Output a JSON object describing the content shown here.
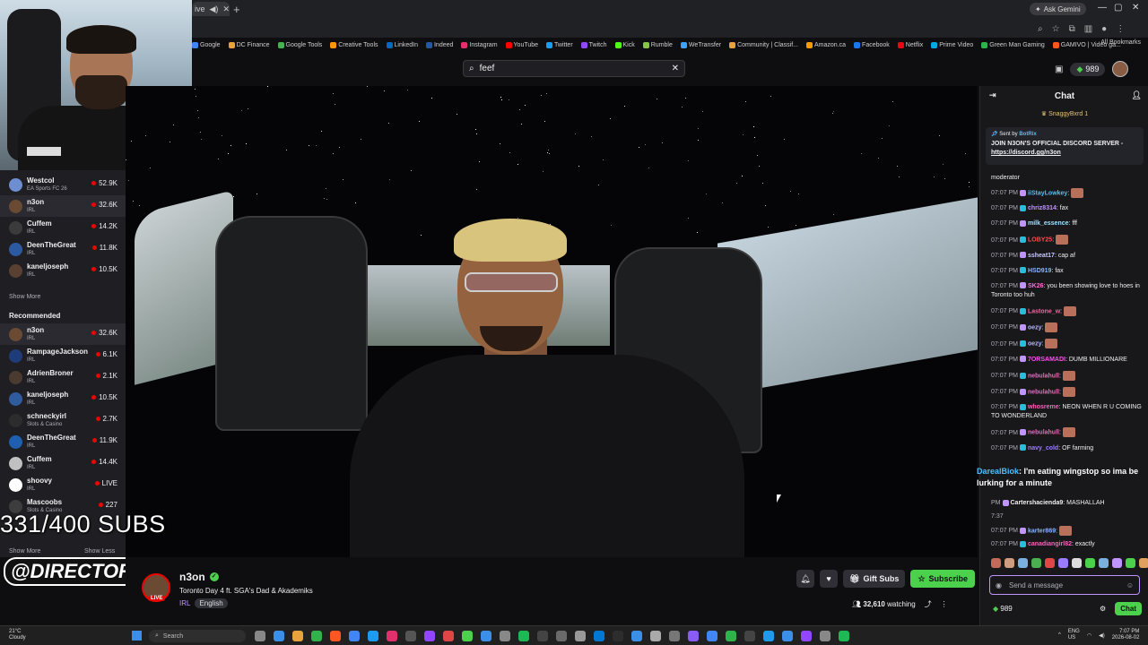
{
  "browser": {
    "tab_title": "ive",
    "ask_gemini": "Ask Gemini",
    "bookmarks": [
      "Google",
      "DC Finance",
      "Google Tools",
      "Creative Tools",
      "LinkedIn",
      "Indeed",
      "Instagram",
      "YouTube",
      "Twitter",
      "Twitch",
      "Kick",
      "Rumble",
      "WeTransfer",
      "Community | Classif...",
      "Amazon.ca",
      "Facebook",
      "Netflix",
      "Prime Video",
      "Green Man Gaming",
      "GAMIVO | Video ga..."
    ],
    "all_bookmarks": "All Bookmarks"
  },
  "search": {
    "value": "feef"
  },
  "top_right": {
    "bits": "989"
  },
  "sidebar": {
    "followed": [
      {
        "name": "Westcol",
        "category": "EA Sports FC 26",
        "count": "52.9K"
      },
      {
        "name": "n3on",
        "category": "IRL",
        "count": "32.6K"
      },
      {
        "name": "Cuffem",
        "category": "IRL",
        "count": "14.2K"
      },
      {
        "name": "DeenTheGreat",
        "category": "IRL",
        "count": "11.8K"
      },
      {
        "name": "kaneljoseph",
        "category": "IRL",
        "count": "10.5K"
      }
    ],
    "show_more": "Show More",
    "recommended_heading": "Recommended",
    "recommended": [
      {
        "name": "n3on",
        "category": "IRL",
        "count": "32.6K"
      },
      {
        "name": "RampageJackson",
        "category": "IRL",
        "count": "6.1K"
      },
      {
        "name": "AdrienBroner",
        "category": "IRL",
        "count": "2.1K"
      },
      {
        "name": "kaneljoseph",
        "category": "IRL",
        "count": "10.5K"
      },
      {
        "name": "schneckyirl",
        "category": "Slots & Casino",
        "count": "2.7K"
      },
      {
        "name": "DeenTheGreat",
        "category": "IRL",
        "count": "11.9K"
      },
      {
        "name": "Cuffem",
        "category": "IRL",
        "count": "14.4K"
      },
      {
        "name": "shoovy",
        "category": "IRL",
        "count": "LIVE"
      },
      {
        "name": "Mascoobs",
        "category": "Slots & Casino",
        "count": "227"
      }
    ],
    "show_more_2": "Show More",
    "show_less": "Show Less"
  },
  "overlay": {
    "subs": "331/400 SUBS",
    "handle": "@DIRECTORICY"
  },
  "stream": {
    "channel": "n3on",
    "live": "LIVE",
    "title": "Toronto Day 4 ft. SGA's Dad & Akademiks",
    "category": "IRL",
    "language": "English",
    "gift_subs": "Gift Subs",
    "subscribe": "Subscribe",
    "viewers": "32,610",
    "watching": "watching"
  },
  "chat": {
    "header": "Chat",
    "gifter": "SnaggyBxrd 1",
    "pinned_from_label": "Sent by",
    "pinned_from": "BotRix",
    "pinned_msg": "JOIN N3ON'S OFFICIAL DISCORD SERVER -",
    "pinned_link": "https://discord.gg/n3on",
    "moderator": "moderator",
    "messages": [
      {
        "time": "07:07 PM",
        "user": "iiStayLowkey",
        "color": "#49c1ff",
        "text": ""
      },
      {
        "time": "07:07 PM",
        "user": "chriz8314",
        "color": "#bf94ff",
        "text": "fax"
      },
      {
        "time": "07:07 PM",
        "user": "milk_essence",
        "color": "#a0e0ff",
        "text": "fff"
      },
      {
        "time": "07:07 PM",
        "user": "LOBY25",
        "color": "#ff4c4c",
        "text": ""
      },
      {
        "time": "07:07 PM",
        "user": "ssheat17",
        "color": "#c7c7ff",
        "text": "cap af"
      },
      {
        "time": "07:07 PM",
        "user": "HSD919",
        "color": "#8ab4ff",
        "text": "fax"
      },
      {
        "time": "07:07 PM",
        "user": "SK26",
        "color": "#ff6bd5",
        "text": "you been showing love to hoes in Toronto too huh"
      },
      {
        "time": "07:07 PM",
        "user": "Lastone_w",
        "color": "#ff5fa2",
        "text": ""
      },
      {
        "time": "07:07 PM",
        "user": "oezy",
        "color": "#b4b4ff",
        "text": ""
      },
      {
        "time": "07:07 PM",
        "user": "oezy",
        "color": "#b4b4ff",
        "text": ""
      },
      {
        "time": "07:07 PM",
        "user": "7ORSAMADI",
        "color": "#ff4df0",
        "text": "DUMB MILLIONARE"
      },
      {
        "time": "07:07 PM",
        "user": "nebulahull",
        "color": "#ff5fbf",
        "text": ""
      },
      {
        "time": "07:07 PM",
        "user": "nebulahull",
        "color": "#ff5fbf",
        "text": ""
      },
      {
        "time": "07:07 PM",
        "user": "whosreme",
        "color": "#ff5fbf",
        "text": "NEON WHEN R U COMING TO WONDERLAND"
      },
      {
        "time": "07:07 PM",
        "user": "nebulahull",
        "color": "#ff5fbf",
        "text": ""
      },
      {
        "time": "07:07 PM",
        "user": "navy_cold",
        "color": "#9b7bff",
        "text": "OF farming"
      }
    ],
    "big_user": "DarealBiok",
    "big_text": ": I'm eating wingstop so ima be lurking for a minute",
    "after": [
      {
        "time": "PM",
        "user": "Cartershacienda9",
        "color": "#efeff1",
        "text": "MASHALLAH"
      },
      {
        "time": "7:37",
        "user": "",
        "color": "#efeff1",
        "text": ""
      },
      {
        "time": "07:07 PM",
        "user": "karter869",
        "color": "#8ab4ff",
        "text": ""
      },
      {
        "time": "07:07 PM",
        "user": "canadiangirl82",
        "color": "#ff5fbf",
        "text": "exactly"
      }
    ],
    "input_placeholder": "Send a message",
    "points": "989",
    "send": "Chat"
  },
  "taskbar": {
    "weather_temp": "21°C",
    "weather_desc": "Cloudy",
    "search": "Search",
    "lang": "ENG",
    "region": "US",
    "time": "7:07 PM",
    "date": "2026-08-02"
  }
}
